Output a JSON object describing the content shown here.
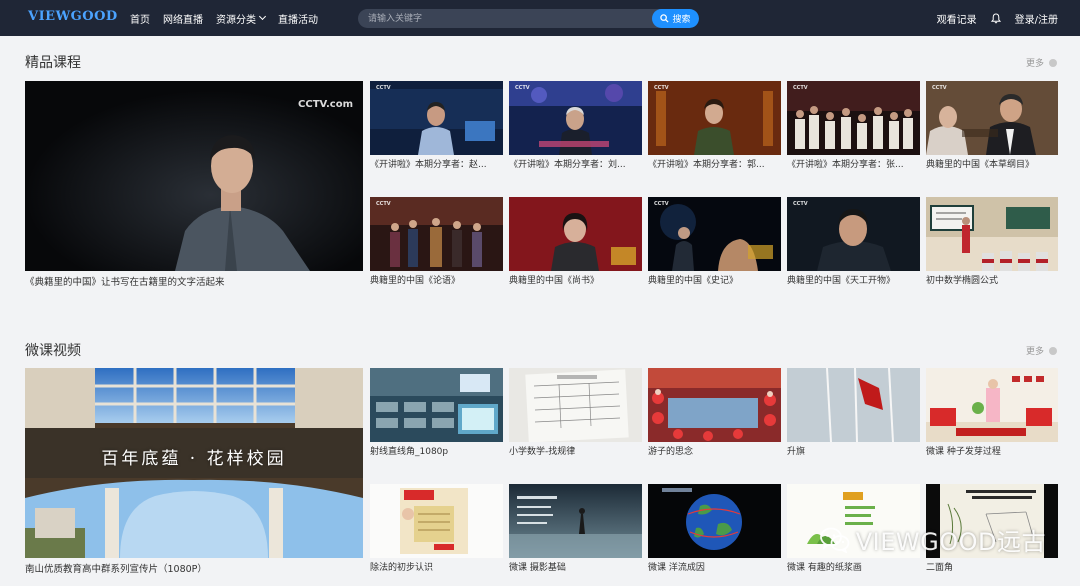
{
  "header": {
    "logo": "VIEWGOOD",
    "nav": [
      {
        "label": "首页"
      },
      {
        "label": "网络直播"
      },
      {
        "label": "资源分类"
      },
      {
        "label": "直播活动"
      }
    ],
    "search": {
      "placeholder": "请输入关键字",
      "button": "搜索"
    },
    "history": "观看记录",
    "login": "登录/注册"
  },
  "sections": [
    {
      "title": "精品课程",
      "more": "更多",
      "featured": {
        "caption": "《典籍里的中国》让书写在古籍里的文字活起来",
        "logo": "CCTV.com"
      },
      "items": [
        {
          "caption": "《开讲啦》本期分享者：赵..."
        },
        {
          "caption": "《开讲啦》本期分享者：刘..."
        },
        {
          "caption": "《开讲啦》本期分享者：郭..."
        },
        {
          "caption": "《开讲啦》本期分享者：张..."
        },
        {
          "caption": "典籍里的中国《本草纲目》"
        },
        {
          "caption": "典籍里的中国《论语》"
        },
        {
          "caption": "典籍里的中国《尚书》"
        },
        {
          "caption": "典籍里的中国《史记》"
        },
        {
          "caption": "典籍里的中国《天工开物》"
        },
        {
          "caption": "初中数学椭圆公式"
        }
      ]
    },
    {
      "title": "微课视频",
      "more": "更多",
      "featured": {
        "caption": "南山优质教育高中群系列宣传片（1080P）",
        "overlay": "百年底蕴 · 花样校园"
      },
      "items": [
        {
          "caption": "射线直线角_1080p"
        },
        {
          "caption": "小学数学-找规律"
        },
        {
          "caption": "游子的思念"
        },
        {
          "caption": "升旗"
        },
        {
          "caption": "微课 种子发芽过程"
        },
        {
          "caption": "除法的初步认识"
        },
        {
          "caption": "微课 摄影基础"
        },
        {
          "caption": "微课 洋流成因"
        },
        {
          "caption": "微课 有趣的纸浆画"
        },
        {
          "caption": "二面角"
        }
      ]
    }
  ],
  "watermark": "VIEWGOOD远古"
}
